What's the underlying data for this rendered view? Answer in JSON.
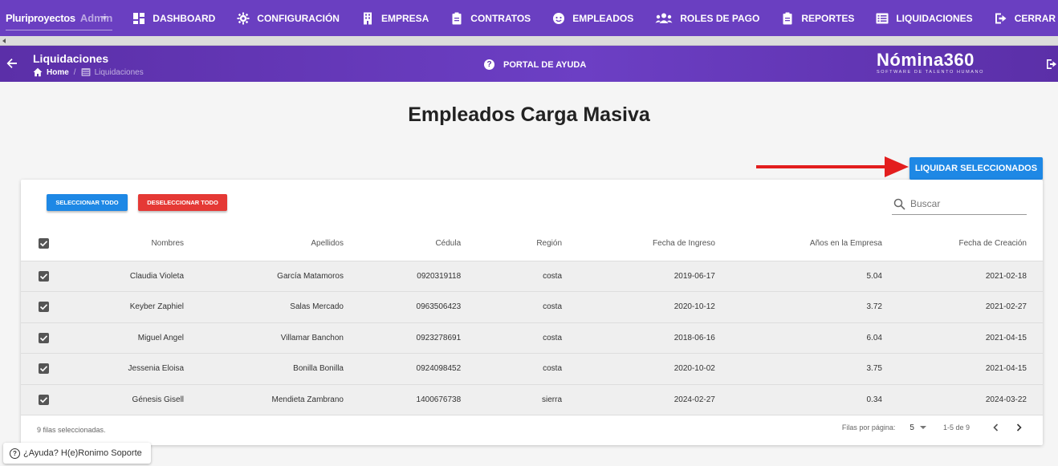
{
  "topnav": {
    "company": "Pluriproyectos",
    "role": "Admin",
    "items": [
      {
        "label": "DASHBOARD",
        "icon": "dashboard-icon"
      },
      {
        "label": "CONFIGURACIÓN",
        "icon": "gear-icon"
      },
      {
        "label": "EMPRESA",
        "icon": "building-icon"
      },
      {
        "label": "CONTRATOS",
        "icon": "clipboard-icon"
      },
      {
        "label": "EMPLEADOS",
        "icon": "face-icon"
      },
      {
        "label": "ROLES DE PAGO",
        "icon": "users-icon"
      },
      {
        "label": "REPORTES",
        "icon": "clipboard-icon"
      },
      {
        "label": "LIQUIDACIONES",
        "icon": "list-icon"
      },
      {
        "label": "CERRAR SESIÓN",
        "icon": "logout-icon"
      }
    ]
  },
  "subheader": {
    "title": "Liquidaciones",
    "breadcrumb_home": "Home",
    "breadcrumb_current": "Liquidaciones",
    "help_portal": "PORTAL DE AYUDA",
    "logo_name": "Nómina360",
    "logo_tagline": "SOFTWARE DE TALENTO HUMANO"
  },
  "main": {
    "title": "Empleados Carga Masiva",
    "liquidar_label": "LIQUIDAR SELECCIONADOS"
  },
  "card": {
    "select_all_label": "SELECCIONAR TODO",
    "deselect_all_label": "DESELECCIONAR TODO",
    "search_placeholder": "Buscar",
    "columns": [
      "Nombres",
      "Apellidos",
      "Cédula",
      "Región",
      "Fecha de Ingreso",
      "Años en la Empresa",
      "Fecha de Creación"
    ],
    "rows": [
      {
        "nombres": "Claudia Violeta",
        "apellidos": "García Matamoros",
        "cedula": "0920319118",
        "region": "costa",
        "ingreso": "2019-06-17",
        "anios": "5.04",
        "creacion": "2021-02-18"
      },
      {
        "nombres": "Keyber Zaphiel",
        "apellidos": "Salas Mercado",
        "cedula": "0963506423",
        "region": "costa",
        "ingreso": "2020-10-12",
        "anios": "3.72",
        "creacion": "2021-02-27"
      },
      {
        "nombres": "Miguel Angel",
        "apellidos": "Villamar Banchon",
        "cedula": "0923278691",
        "region": "costa",
        "ingreso": "2018-06-16",
        "anios": "6.04",
        "creacion": "2021-04-15"
      },
      {
        "nombres": "Jessenia Eloisa",
        "apellidos": "Bonilla Bonilla",
        "cedula": "0924098452",
        "region": "costa",
        "ingreso": "2020-10-02",
        "anios": "3.75",
        "creacion": "2021-04-15"
      },
      {
        "nombres": "Génesis Gisell",
        "apellidos": "Mendieta Zambrano",
        "cedula": "1400676738",
        "region": "sierra",
        "ingreso": "2024-02-27",
        "anios": "0.34",
        "creacion": "2024-03-22"
      }
    ],
    "selected_text": "9 filas seleccionadas.",
    "rows_per_page_label": "Filas por página:",
    "rows_per_page_value": "5",
    "range_text": "1-5 de 9"
  },
  "help_chip": {
    "label": "¿Ayuda? H(e)Ronimo Soporte"
  },
  "colors": {
    "nav_purple": "#6a3fc1",
    "primary_blue": "#1e88e5",
    "danger_red": "#e53935",
    "arrow_red": "#e31e1e"
  }
}
